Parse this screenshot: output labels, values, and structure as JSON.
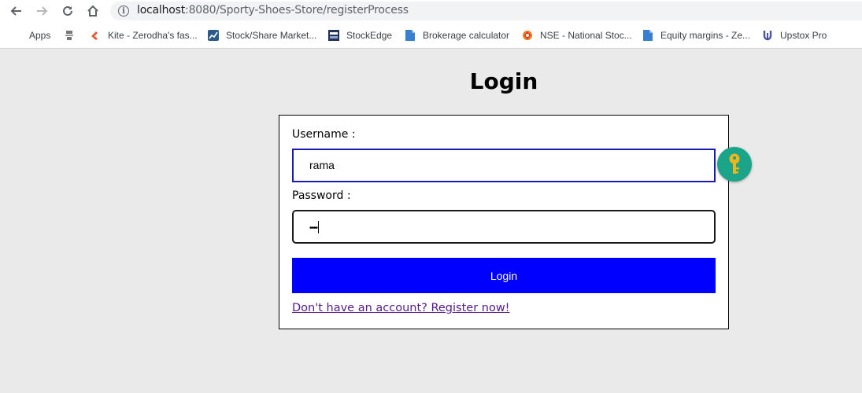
{
  "browser": {
    "url_host": "localhost",
    "url_path": ":8080/Sporty-Shoes-Store/registerProcess",
    "nav": {
      "back_icon": "arrow-left-icon",
      "forward_icon": "arrow-right-icon",
      "reload_icon": "reload-icon",
      "home_icon": "home-icon"
    }
  },
  "bookmarks": [
    {
      "label": "Apps",
      "icon": "apps-grid-icon"
    },
    {
      "label": "",
      "icon": "emblem-icon"
    },
    {
      "label": "Kite - Zerodha's fas...",
      "icon": "kite-icon"
    },
    {
      "label": "Stock/Share Market...",
      "icon": "chart-icon"
    },
    {
      "label": "StockEdge",
      "icon": "stockedge-icon"
    },
    {
      "label": "Brokerage calculator",
      "icon": "doc-icon"
    },
    {
      "label": "NSE - National Stoc...",
      "icon": "nse-icon"
    },
    {
      "label": "Equity margins - Ze...",
      "icon": "doc-icon"
    },
    {
      "label": "Upstox Pro",
      "icon": "upstox-icon"
    }
  ],
  "page": {
    "title": "Login",
    "username_label": "Username :",
    "username_value": "rama",
    "password_label": "Password :",
    "password_masked": "••••",
    "login_button": "Login",
    "register_link": "Don't have an account? Register now!"
  },
  "colors": {
    "accent_button": "#0000ff",
    "focus_border": "#1a1ab8",
    "link_visited": "#551a8b",
    "key_badge": "#1aa58a",
    "key_color": "#f2b417"
  }
}
